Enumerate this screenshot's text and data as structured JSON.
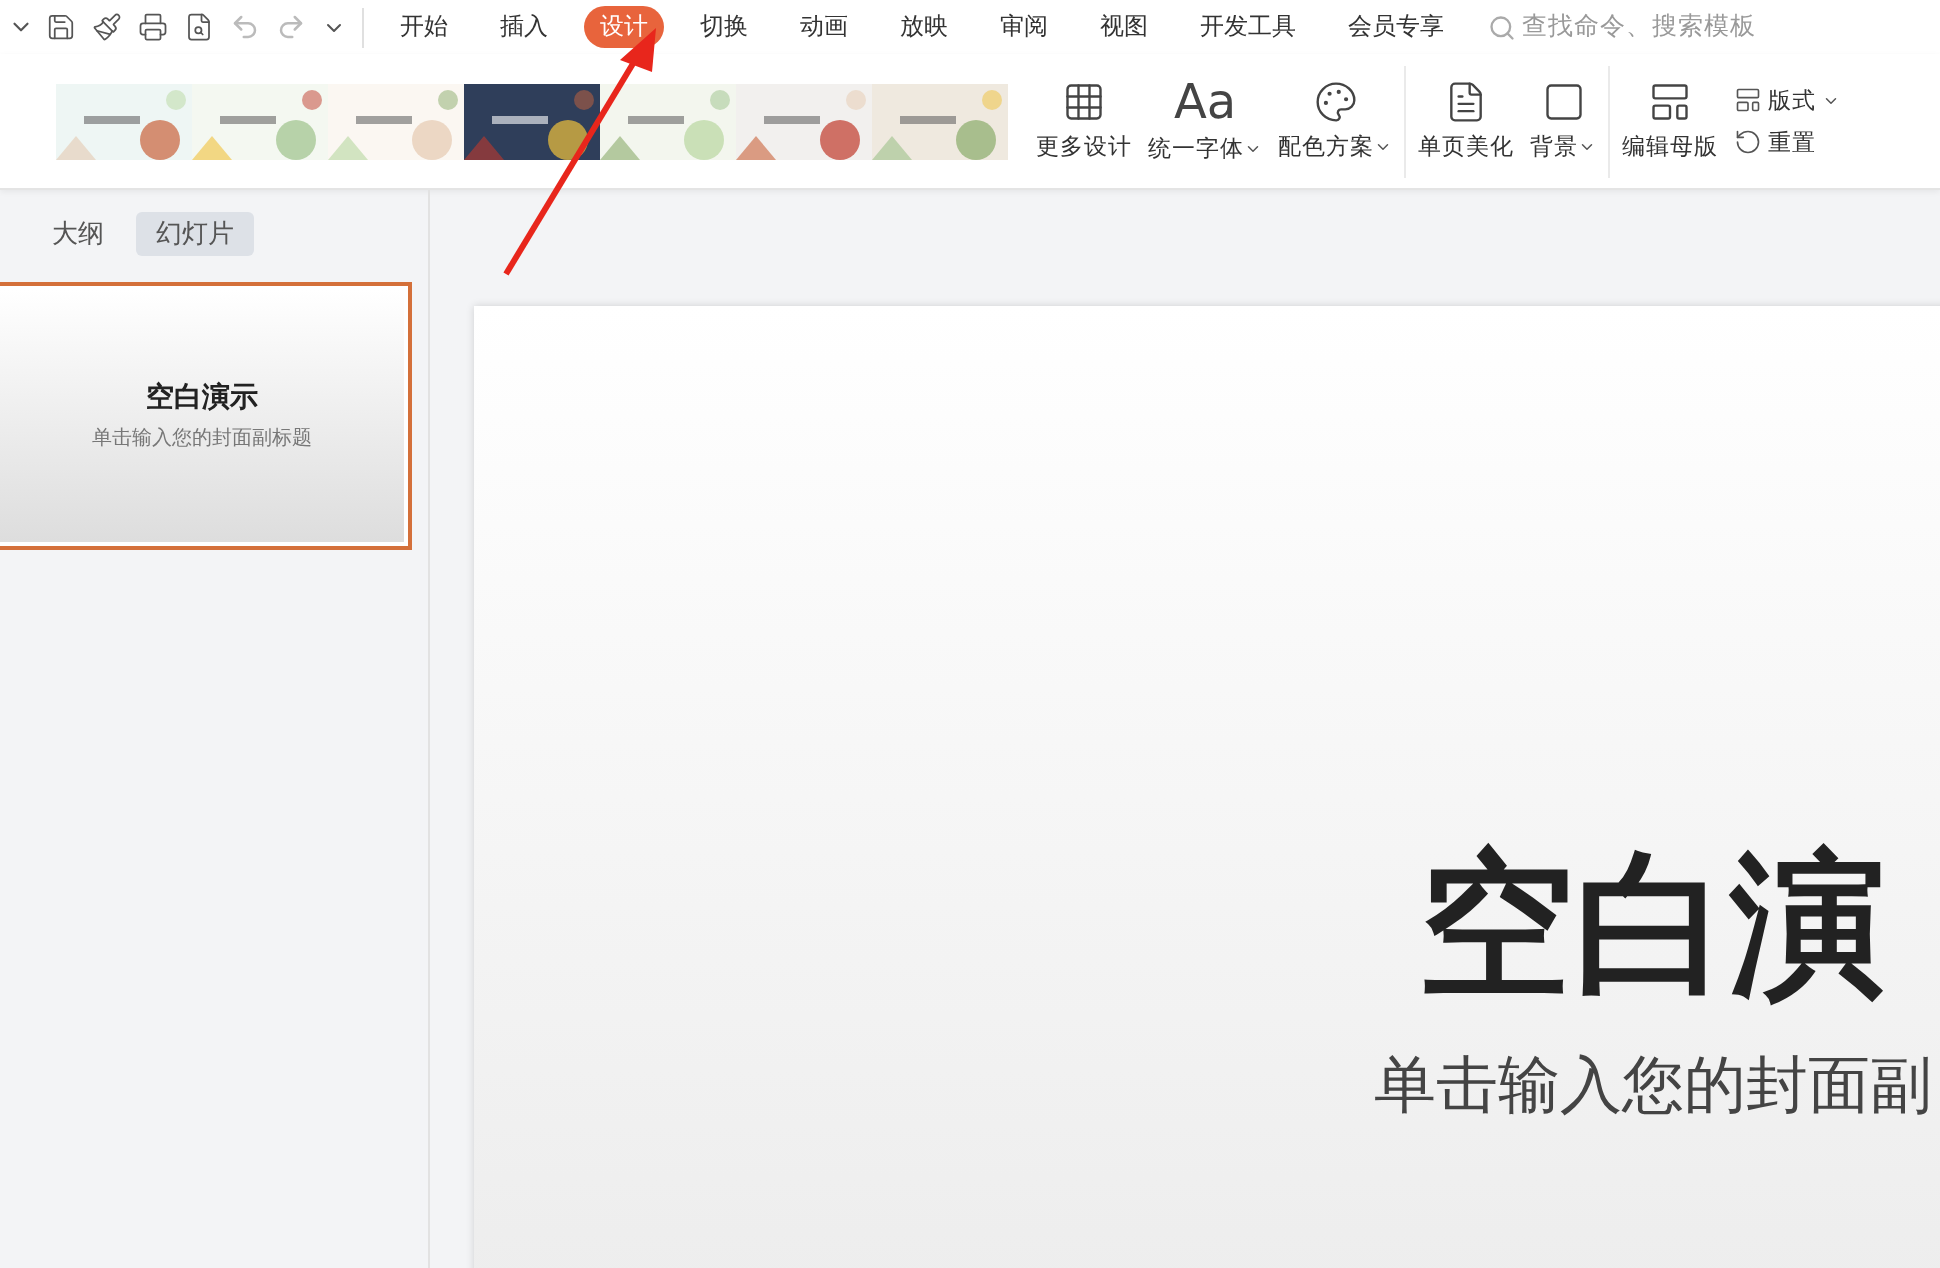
{
  "menu_tabs": [
    {
      "label": "开始",
      "selected": false
    },
    {
      "label": "插入",
      "selected": false
    },
    {
      "label": "设计",
      "selected": true
    },
    {
      "label": "切换",
      "selected": false
    },
    {
      "label": "动画",
      "selected": false
    },
    {
      "label": "放映",
      "selected": false
    },
    {
      "label": "审阅",
      "selected": false
    },
    {
      "label": "视图",
      "selected": false
    },
    {
      "label": "开发工具",
      "selected": false
    },
    {
      "label": "会员专享",
      "selected": false
    }
  ],
  "search": {
    "placeholder": "查找命令、搜索模板"
  },
  "tools": [
    {
      "kind": "grid",
      "label": "更多设计",
      "dropdown": false
    },
    {
      "kind": "font",
      "glyph": "Aa",
      "label": "统一字体",
      "dropdown": true
    },
    {
      "kind": "palette",
      "label": "配色方案",
      "dropdown": true
    },
    {
      "kind": "page",
      "label": "单页美化",
      "dropdown": false
    },
    {
      "kind": "background",
      "label": "背景",
      "dropdown": true
    },
    {
      "kind": "master",
      "label": "编辑母版",
      "dropdown": false
    }
  ],
  "small_tools": [
    {
      "kind": "layout",
      "label": "版式",
      "dropdown": true
    },
    {
      "kind": "reset",
      "label": "重置",
      "dropdown": false
    }
  ],
  "panel_tabs": [
    {
      "label": "大纲",
      "selected": false
    },
    {
      "label": "幻灯片",
      "selected": true
    }
  ],
  "thumbnail": {
    "selected": true,
    "title": "空白演示",
    "subtitle": "单击输入您的封面副标题"
  },
  "slide": {
    "title": "空白演",
    "subtitle": "单击输入您的封面副"
  }
}
